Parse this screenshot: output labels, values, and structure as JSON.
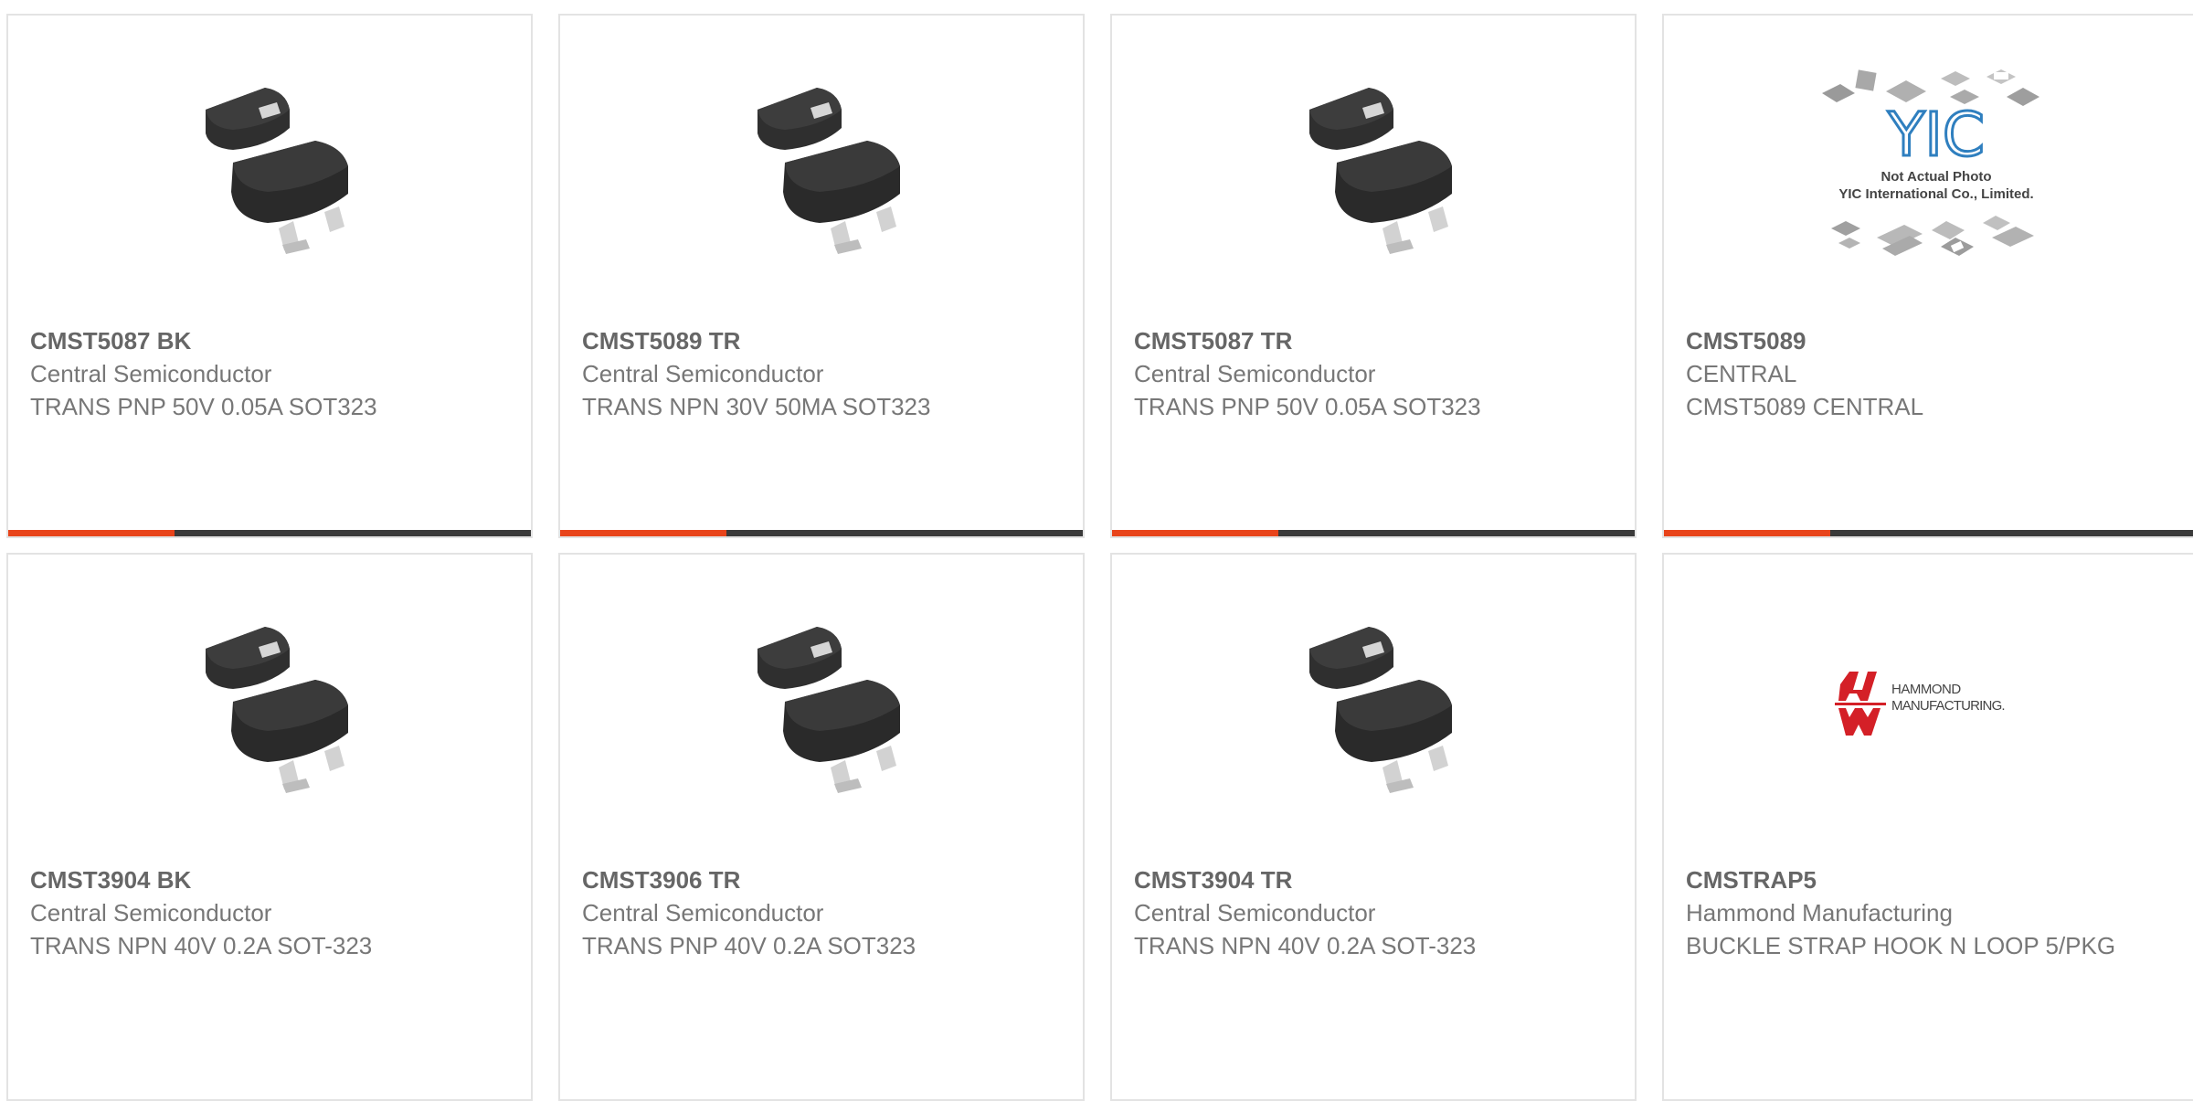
{
  "accent_color": "#e8441b",
  "products": [
    {
      "part": "CMST5087 BK",
      "manufacturer": "Central Semiconductor",
      "description": "TRANS PNP 50V 0.05A SOT323",
      "image": "sot323-transistor-icon"
    },
    {
      "part": "CMST5089 TR",
      "manufacturer": "Central Semiconductor",
      "description": "TRANS NPN 30V 50MA SOT323",
      "image": "sot323-transistor-icon"
    },
    {
      "part": "CMST5087 TR",
      "manufacturer": "Central Semiconductor",
      "description": "TRANS PNP 50V 0.05A SOT323",
      "image": "sot323-transistor-icon"
    },
    {
      "part": "CMST5089",
      "manufacturer": "CENTRAL",
      "description": "CMST5089 CENTRAL",
      "image": "yic-placeholder-icon",
      "image_text": {
        "logo": "YIC",
        "line1": "Not Actual Photo",
        "line2": "YIC International Co., Limited."
      }
    },
    {
      "part": "CMST3904 BK",
      "manufacturer": "Central Semiconductor",
      "description": "TRANS NPN 40V 0.2A SOT-323",
      "image": "sot323-transistor-icon"
    },
    {
      "part": "CMST3906 TR",
      "manufacturer": "Central Semiconductor",
      "description": "TRANS PNP 40V 0.2A SOT323",
      "image": "sot323-transistor-icon"
    },
    {
      "part": "CMST3904 TR",
      "manufacturer": "Central Semiconductor",
      "description": "TRANS NPN 40V 0.2A SOT-323",
      "image": "sot323-transistor-icon"
    },
    {
      "part": "CMSTRAP5",
      "manufacturer": "Hammond Manufacturing",
      "description": "BUCKLE STRAP HOOK N LOOP 5/PKG",
      "image": "hammond-logo-icon",
      "image_text": {
        "line1": "HAMMOND",
        "line2": "MANUFACTURING."
      }
    }
  ]
}
